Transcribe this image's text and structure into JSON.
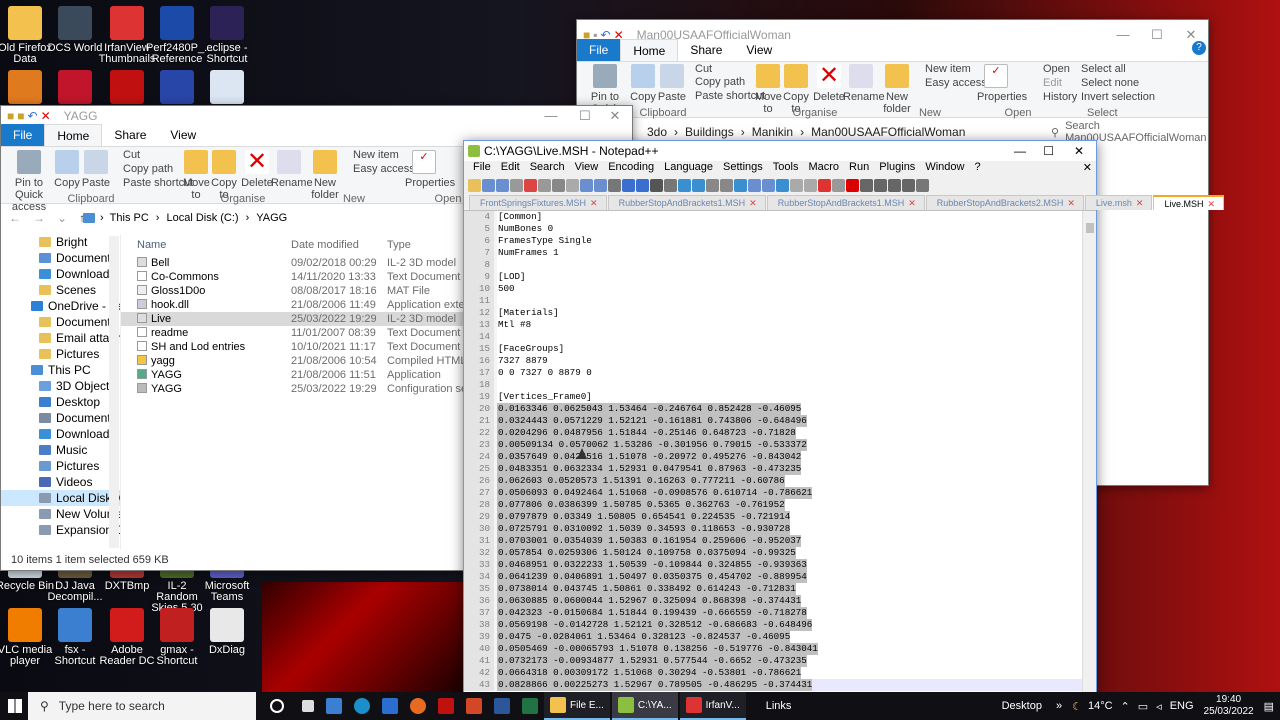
{
  "desktop_top": [
    {
      "l1": "Old Firefox",
      "l2": "Data",
      "c": "#f2c14e"
    },
    {
      "l1": "DCS World",
      "l2": "",
      "c": "#3a4a5a"
    },
    {
      "l1": "IrfanView",
      "l2": "Thumbnails",
      "c": "#d33"
    },
    {
      "l1": "Perf2480P_...",
      "l2": "Reference ...",
      "c": "#1b4aa8"
    },
    {
      "l1": "eclipse -",
      "l2": "Shortcut",
      "c": "#2c2255"
    }
  ],
  "desktop_mid": [
    {
      "c": "#e07a1f"
    },
    {
      "c": "#c0152a"
    },
    {
      "c": "#c01010"
    },
    {
      "c": "#2845a8"
    },
    {
      "c": "#dce6f2"
    }
  ],
  "desktop_bottom1": [
    {
      "l1": "Recycle Bin",
      "l2": "",
      "c": "#cfd8e2"
    },
    {
      "l1": "DJ Java",
      "l2": "Decompil...",
      "c": "#6a5a3a"
    },
    {
      "l1": "DXTBmp",
      "l2": "",
      "c": "#b03535"
    },
    {
      "l1": "IL-2 Random",
      "l2": "Skies 5.30 O...",
      "c": "#4a6a2a"
    },
    {
      "l1": "Microsoft",
      "l2": "Teams",
      "c": "#5b5fc7"
    }
  ],
  "desktop_bottom2": [
    {
      "l1": "VLC media",
      "l2": "player",
      "c": "#f07d00"
    },
    {
      "l1": "fsx - Shortcut",
      "l2": "",
      "c": "#3a7fd0"
    },
    {
      "l1": "Adobe",
      "l2": "Reader DC",
      "c": "#d21c1c"
    },
    {
      "l1": "gmax -",
      "l2": "Shortcut",
      "c": "#c02020"
    },
    {
      "l1": "DxDiag",
      "l2": "",
      "c": "#e8e8e8"
    }
  ],
  "explorer2": {
    "title": "Man00USAAFOfficialWoman",
    "tabs": [
      "File",
      "Home",
      "Share",
      "View"
    ],
    "groups": [
      "Clipboard",
      "Organise",
      "New",
      "Open",
      "Select"
    ],
    "big": [
      "Pin to Quick access",
      "Copy",
      "Paste",
      "Move to",
      "Copy to",
      "Delete",
      "Rename",
      "New folder",
      "Properties"
    ],
    "small": {
      "cut": "Cut",
      "copy_path": "Copy path",
      "paste_shortcut": "Paste shortcut",
      "new_item": "New item",
      "easy_access": "Easy access",
      "open": "Open",
      "edit": "Edit",
      "history": "History",
      "select_all": "Select all",
      "select_none": "Select none",
      "invert": "Invert selection"
    },
    "path": [
      "3do",
      "Buildings",
      "Manikin",
      "Man00USAAFOfficialWoman"
    ],
    "search": "Search Man00USAAFOfficialWoman"
  },
  "explorer1": {
    "title": "YAGG",
    "tabs": [
      "File",
      "Home",
      "Share",
      "View"
    ],
    "groups": [
      "Clipboard",
      "Organise",
      "New",
      "Open"
    ],
    "big": [
      "Pin to Quick access",
      "Copy",
      "Paste",
      "Move to",
      "Copy to",
      "Delete",
      "Rename",
      "New folder",
      "Properties"
    ],
    "small": {
      "cut": "Cut",
      "copy_path": "Copy path",
      "paste_shortcut": "Paste shortcut",
      "new_item": "New item",
      "easy_access": "Easy access"
    },
    "path": [
      "This PC",
      "Local Disk (C:)",
      "YAGG"
    ],
    "nav": [
      {
        "t": "Bright",
        "c": "#e8c15a"
      },
      {
        "t": "Documents",
        "c": "#5b8fd6"
      },
      {
        "t": "Downloads",
        "c": "#3a8fd6"
      },
      {
        "t": "Scenes",
        "c": "#e8c15a"
      },
      {
        "t": "OneDrive - Personal",
        "c": "#2a7fd6"
      },
      {
        "t": "Documents",
        "c": "#e8c15a"
      },
      {
        "t": "Email attachments",
        "c": "#e8c15a"
      },
      {
        "t": "Pictures",
        "c": "#e8c15a"
      },
      {
        "t": "This PC",
        "c": "#4a8fd6"
      },
      {
        "t": "3D Objects",
        "c": "#6aa0e0"
      },
      {
        "t": "Desktop",
        "c": "#3a7fd0"
      },
      {
        "t": "Documents",
        "c": "#7a8aa0"
      },
      {
        "t": "Downloads",
        "c": "#3a8fd6"
      },
      {
        "t": "Music",
        "c": "#4a7fc8"
      },
      {
        "t": "Pictures",
        "c": "#6a9ad0"
      },
      {
        "t": "Videos",
        "c": "#4a6ab8"
      },
      {
        "t": "Local Disk (C:)",
        "c": "#8a9ab0"
      },
      {
        "t": "New Volume (E:)",
        "c": "#8a9ab0"
      },
      {
        "t": "Expansion Drive (G:",
        "c": "#8a9ab0"
      }
    ],
    "columns": [
      "Name",
      "Date modified",
      "Type"
    ],
    "files": [
      {
        "n": "Bell",
        "d": "09/02/2018 00:29",
        "t": "IL-2 3D model",
        "c": "#ddd"
      },
      {
        "n": "Co-Commons",
        "d": "14/11/2020 13:33",
        "t": "Text Document",
        "c": "#fff"
      },
      {
        "n": "Gloss1D0o",
        "d": "08/08/2017 18:16",
        "t": "MAT File",
        "c": "#eee"
      },
      {
        "n": "hook.dll",
        "d": "21/08/2006 11:49",
        "t": "Application exte",
        "c": "#ccd"
      },
      {
        "n": "Live",
        "d": "25/03/2022 19:29",
        "t": "IL-2 3D model",
        "c": "#ddd"
      },
      {
        "n": "readme",
        "d": "11/01/2007 08:39",
        "t": "Text Document",
        "c": "#fff"
      },
      {
        "n": "SH and Lod entries",
        "d": "10/10/2021 11:17",
        "t": "Text Document",
        "c": "#fff"
      },
      {
        "n": "yagg",
        "d": "21/08/2006 10:54",
        "t": "Compiled HTML",
        "c": "#f5c542"
      },
      {
        "n": "YAGG",
        "d": "21/08/2006 11:51",
        "t": "Application",
        "c": "#5a8"
      },
      {
        "n": "YAGG",
        "d": "25/03/2022 19:29",
        "t": "Configuration se",
        "c": "#bbb"
      }
    ],
    "status": "10 items    1 item selected  659 KB"
  },
  "notepad": {
    "title": "C:\\YAGG\\Live.MSH - Notepad++",
    "menu": [
      "File",
      "Edit",
      "Search",
      "View",
      "Encoding",
      "Language",
      "Settings",
      "Tools",
      "Macro",
      "Run",
      "Plugins",
      "Window",
      "?"
    ],
    "tabs": [
      "FrontSpringsFixtures.MSH",
      "RubberStopAndBrackets1.MSH",
      "RubberStopAndBrackets1.MSH",
      "RubberStopAndBrackets2.MSH",
      "Live.msh",
      "Live.MSH"
    ],
    "lines": [
      {
        "n": "4",
        "t": "[Common]",
        "s": 0
      },
      {
        "n": "5",
        "t": "NumBones 0",
        "s": 0
      },
      {
        "n": "6",
        "t": "FramesType Single",
        "s": 0
      },
      {
        "n": "7",
        "t": "NumFrames 1",
        "s": 0
      },
      {
        "n": "8",
        "t": "",
        "s": 0
      },
      {
        "n": "9",
        "t": "[LOD]",
        "s": 0
      },
      {
        "n": "10",
        "t": "500",
        "s": 0
      },
      {
        "n": "11",
        "t": "",
        "s": 0
      },
      {
        "n": "12",
        "t": "[Materials]",
        "s": 0
      },
      {
        "n": "13",
        "t": "Mtl #8",
        "s": 0
      },
      {
        "n": "14",
        "t": "",
        "s": 0
      },
      {
        "n": "15",
        "t": "[FaceGroups]",
        "s": 0
      },
      {
        "n": "16",
        "t": "7327 8879",
        "s": 0
      },
      {
        "n": "17",
        "t": "0 0 7327 0 8879 0",
        "s": 0
      },
      {
        "n": "18",
        "t": "",
        "s": 0
      },
      {
        "n": "19",
        "t": "[Vertices_Frame0]",
        "s": 0
      },
      {
        "n": "20",
        "t": "0.0163346 0.0625043 1.53464 -0.246764 0.852428 -0.46095",
        "s": 1
      },
      {
        "n": "21",
        "t": "0.0324443 0.0571229 1.52121 -0.161881 0.743806 -0.648496",
        "s": 1
      },
      {
        "n": "22",
        "t": "0.0204296 0.0487956 1.51844 -0.25146 0.648723 -0.71828",
        "s": 1
      },
      {
        "n": "23",
        "t": "0.00509134 0.0570062 1.53286 -0.301956 0.79015 -0.533372",
        "s": 1
      },
      {
        "n": "24",
        "t": "0.0357649 0.0426516 1.51078 -0.20972 0.495276 -0.843042",
        "s": 1
      },
      {
        "n": "25",
        "t": "0.0483351 0.0632334 1.52931 0.0479541 0.87963 -0.473235",
        "s": 1
      },
      {
        "n": "26",
        "t": "0.062603 0.0520573 1.51391 0.16263 0.777211 -0.60786",
        "s": 1
      },
      {
        "n": "27",
        "t": "0.0506093 0.0492464 1.51068 -0.0908576 0.610714 -0.786621",
        "s": 1
      },
      {
        "n": "28",
        "t": "0.077806 0.0386399 1.50785 0.5365 0.362763 -0.761952",
        "s": 1
      },
      {
        "n": "29",
        "t": "0.0797879 0.03349 1.50805 0.654541 0.224535 -0.721914",
        "s": 1
      },
      {
        "n": "30",
        "t": "0.0725791 0.0310092 1.5039 0.34593 0.118653 -0.930728",
        "s": 1
      },
      {
        "n": "31",
        "t": "0.0703001 0.0354039 1.50383 0.161954 0.259606 -0.952037",
        "s": 1
      },
      {
        "n": "32",
        "t": "0.057854 0.0259306 1.50124 0.109758 0.0375094 -0.99325",
        "s": 1
      },
      {
        "n": "33",
        "t": "0.0468951 0.0322233 1.50539 -0.109844 0.324855 -0.939363",
        "s": 1
      },
      {
        "n": "34",
        "t": "0.0641239 0.0406891 1.50497 0.0350375 0.454702 -0.889954",
        "s": 1
      },
      {
        "n": "35",
        "t": "0.0738014 0.043745 1.50861 0.338492 0.614243 -0.712831",
        "s": 1
      },
      {
        "n": "36",
        "t": "0.0630885 0.0600044 1.52967 0.325094 0.868398 -0.374431",
        "s": 1
      },
      {
        "n": "37",
        "t": "0.042323 -0.0150684 1.51844 0.199439 -0.666559 -0.718278",
        "s": 1
      },
      {
        "n": "38",
        "t": "0.0569198 -0.0142728 1.52121 0.328512 -0.686683 -0.648496",
        "s": 1
      },
      {
        "n": "39",
        "t": "0.0475 -0.0284061 1.53464 0.328123 -0.824537 -0.46095",
        "s": 1
      },
      {
        "n": "40",
        "t": "0.0505469 -0.00065793 1.51078 0.138256 -0.519776 -0.843041",
        "s": 1
      },
      {
        "n": "41",
        "t": "0.0732173 -0.00934877 1.52931 0.577544 -0.6652 -0.473235",
        "s": 1
      },
      {
        "n": "42",
        "t": "0.0664318 0.00309172 1.51068 0.30294 -0.53801 -0.786621",
        "s": 1
      },
      {
        "n": "43",
        "t": "0.0828866 0.00225273 1.52967 0.789505 -0.486295 -0.374431",
        "s": 1
      }
    ]
  },
  "taskbar": {
    "search_placeholder": "Type here to search",
    "apps": [
      {
        "t": "File E..."
      },
      {
        "t": "C:\\YA..."
      },
      {
        "t": "IrfanV..."
      }
    ],
    "links": "Links",
    "desktop": "Desktop",
    "temp": "14°C",
    "lang": "ENG",
    "time": "19:40",
    "date": "25/03/2022"
  }
}
